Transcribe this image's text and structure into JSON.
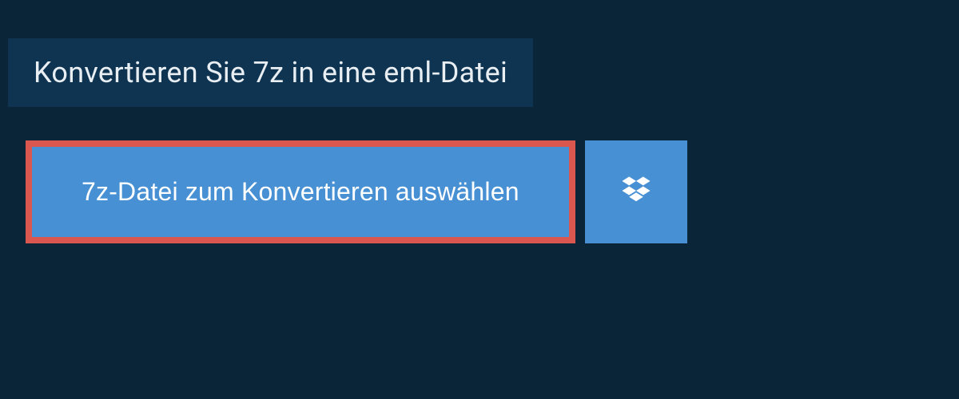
{
  "header": {
    "title": "Konvertieren Sie 7z in eine eml-Datei"
  },
  "actions": {
    "select_file_label": "7z-Datei zum Konvertieren auswählen",
    "dropbox_icon": "dropbox-icon"
  },
  "colors": {
    "page_bg": "#0a2538",
    "header_bg": "#0e3452",
    "button_bg": "#4790d3",
    "highlight_border": "#d9574f",
    "text_light": "#e8eef2"
  }
}
